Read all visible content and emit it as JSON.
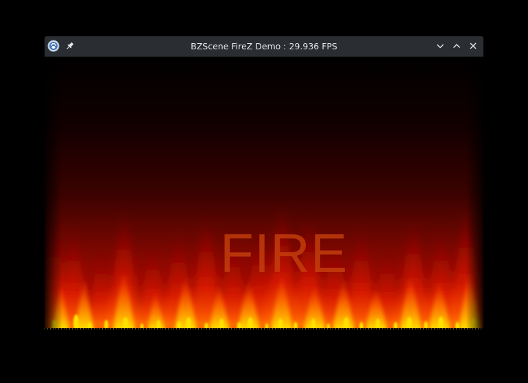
{
  "window": {
    "title": "BZScene FireZ Demo : 29.936 FPS"
  },
  "titlebar": {
    "app_icon": "paw-icon",
    "pin_icon": "pin-icon",
    "minimize_icon": "chevron-down-icon",
    "maximize_icon": "chevron-up-icon",
    "close_icon": "close-icon"
  },
  "scene": {
    "text": "FIRE",
    "text_color": "#c8420e"
  },
  "colors": {
    "titlebar_bg": "#2a2e32",
    "title_text": "#e6e8ea",
    "background": "#000000",
    "flame_red": "#d81400",
    "flame_orange": "#ff6a00",
    "flame_yellow": "#ffe000"
  }
}
